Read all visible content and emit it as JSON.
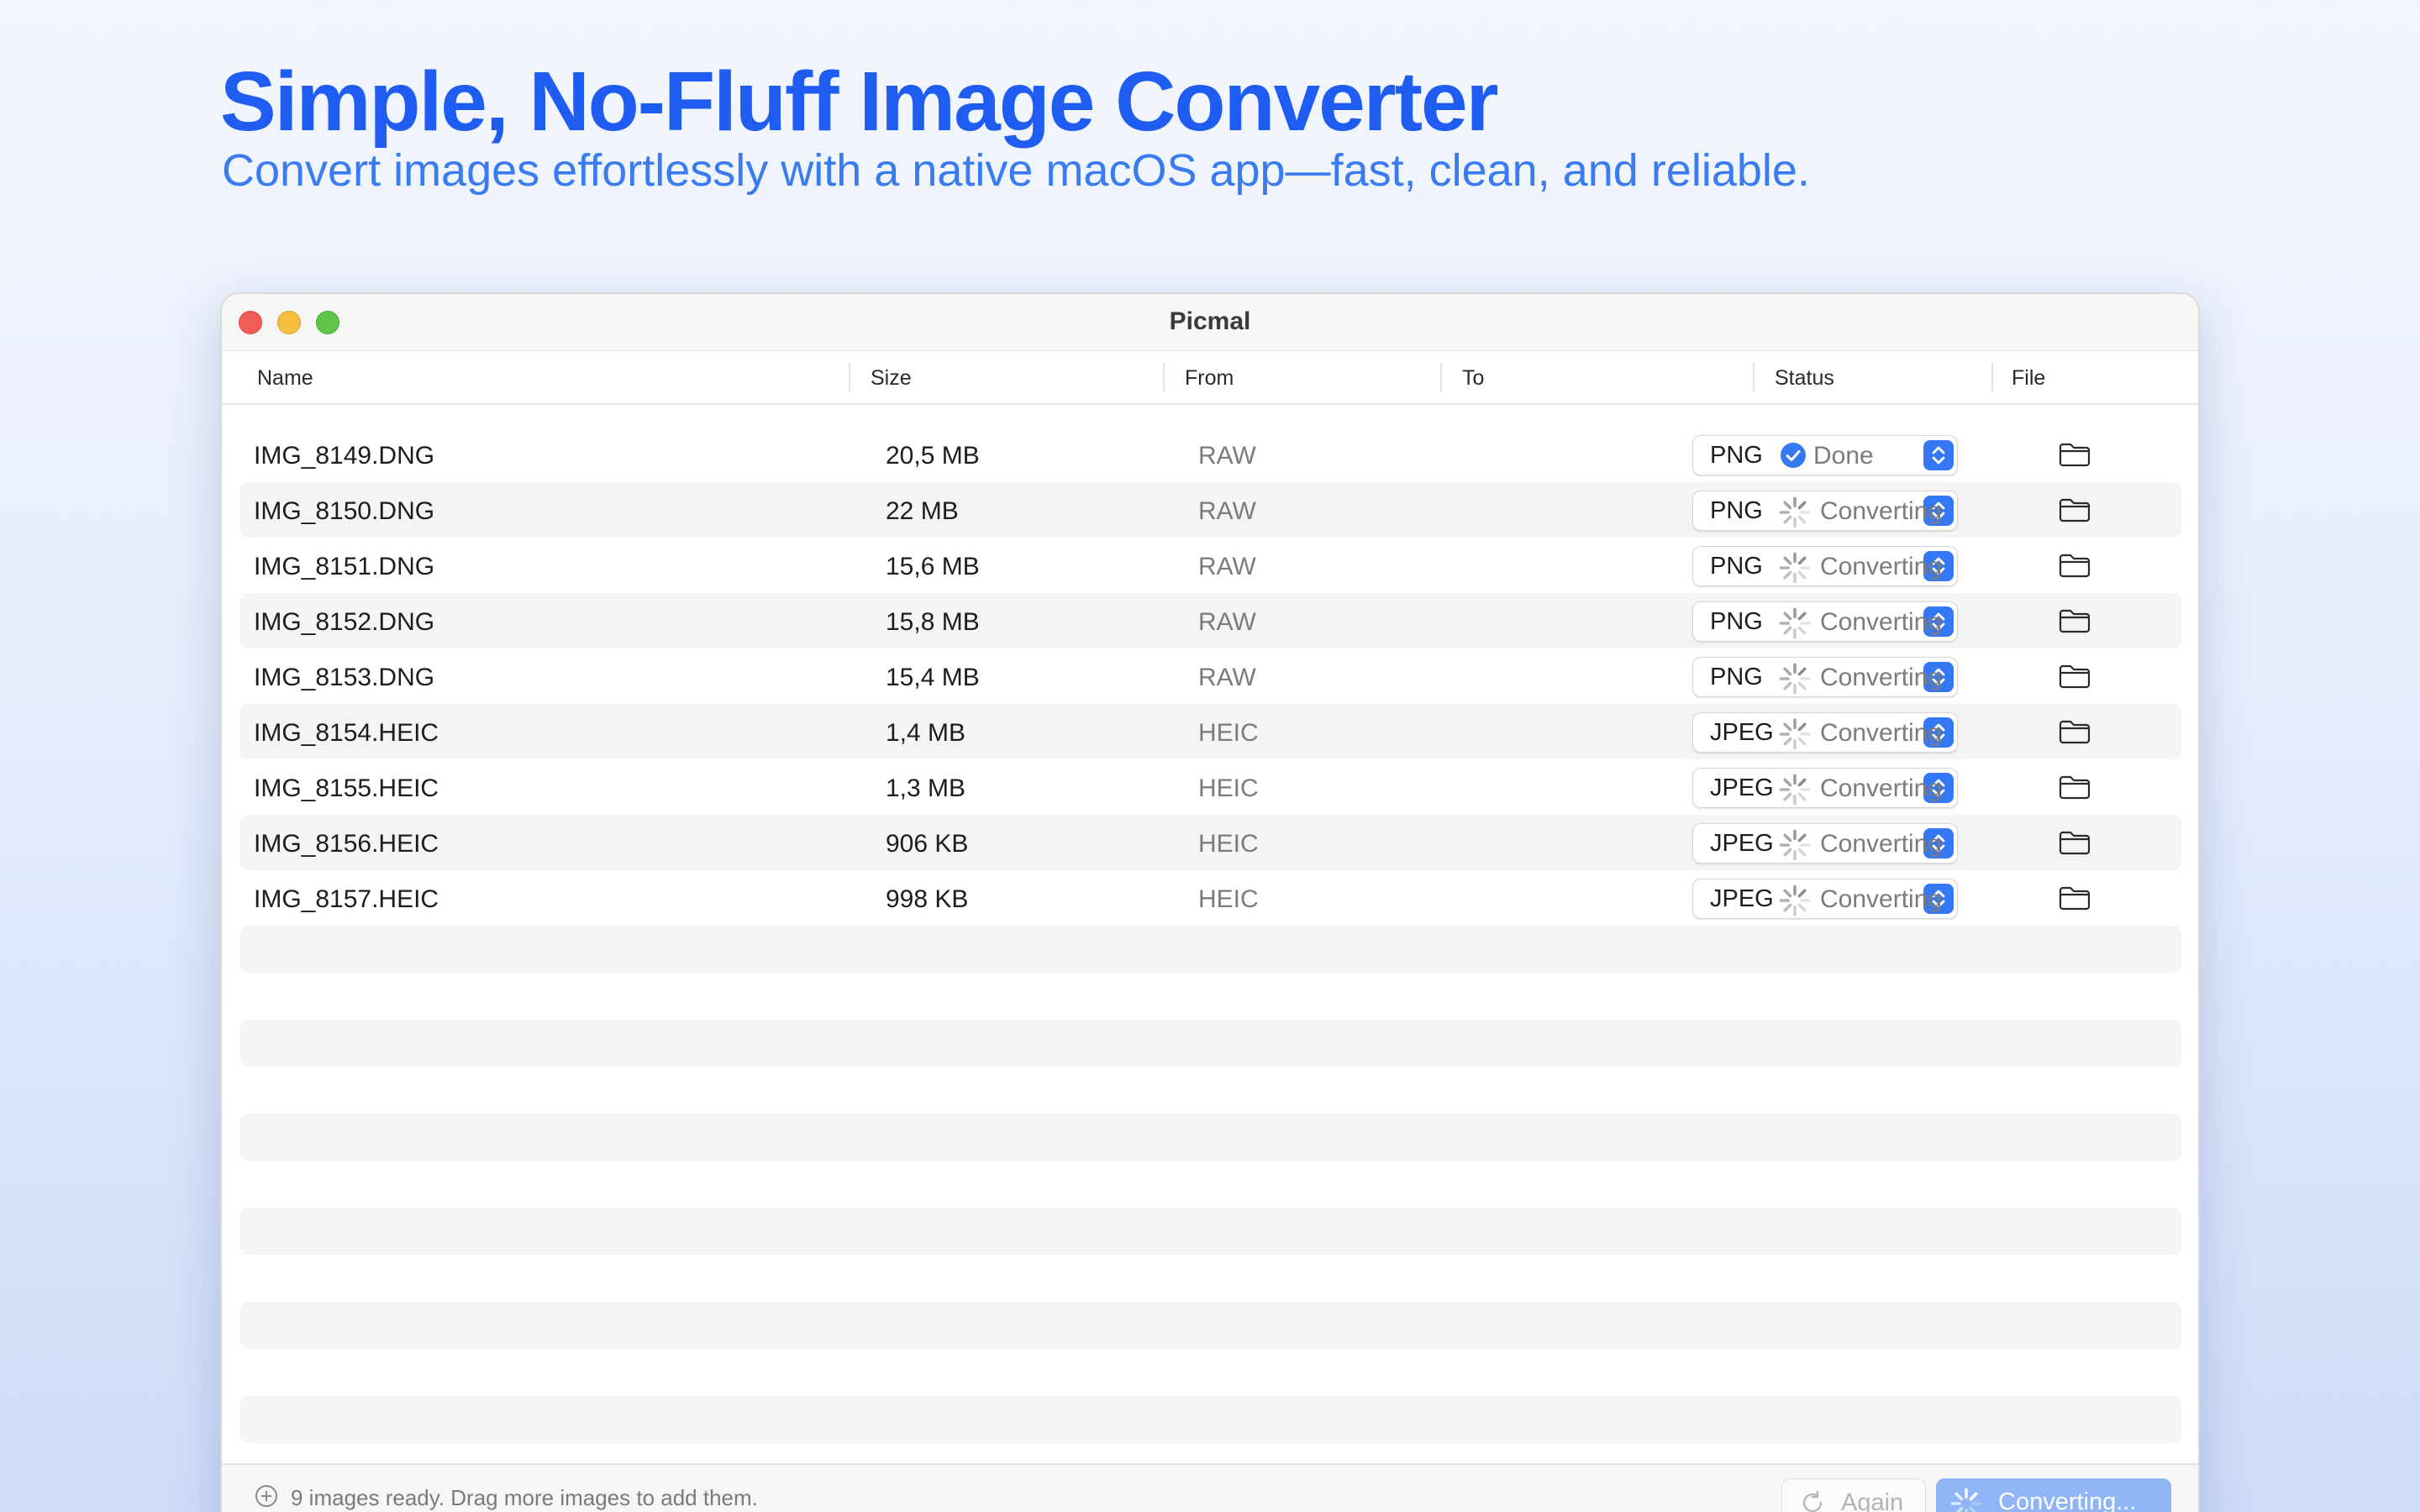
{
  "hero": {
    "title": "Simple, No-Fluff Image Converter",
    "subtitle": "Convert images effortlessly with a native macOS app—fast, clean, and reliable."
  },
  "window": {
    "title": "Picmal"
  },
  "columns": {
    "name": "Name",
    "size": "Size",
    "from": "From",
    "to": "To",
    "status": "Status",
    "file": "File"
  },
  "rows": [
    {
      "name": "IMG_8149.DNG",
      "size": "20,5 MB",
      "from": "RAW",
      "to": "PNG",
      "status": "Done",
      "status_icon": "check-circle-icon"
    },
    {
      "name": "IMG_8150.DNG",
      "size": "22 MB",
      "from": "RAW",
      "to": "PNG",
      "status": "Converting",
      "status_icon": "spinner-icon"
    },
    {
      "name": "IMG_8151.DNG",
      "size": "15,6 MB",
      "from": "RAW",
      "to": "PNG",
      "status": "Converting",
      "status_icon": "spinner-icon"
    },
    {
      "name": "IMG_8152.DNG",
      "size": "15,8 MB",
      "from": "RAW",
      "to": "PNG",
      "status": "Converting",
      "status_icon": "spinner-icon"
    },
    {
      "name": "IMG_8153.DNG",
      "size": "15,4 MB",
      "from": "RAW",
      "to": "PNG",
      "status": "Converting",
      "status_icon": "spinner-icon"
    },
    {
      "name": "IMG_8154.HEIC",
      "size": "1,4 MB",
      "from": "HEIC",
      "to": "JPEG",
      "status": "Converting",
      "status_icon": "spinner-icon"
    },
    {
      "name": "IMG_8155.HEIC",
      "size": "1,3 MB",
      "from": "HEIC",
      "to": "JPEG",
      "status": "Converting",
      "status_icon": "spinner-icon"
    },
    {
      "name": "IMG_8156.HEIC",
      "size": "906 KB",
      "from": "HEIC",
      "to": "JPEG",
      "status": "Converting",
      "status_icon": "spinner-icon"
    },
    {
      "name": "IMG_8157.HEIC",
      "size": "998 KB",
      "from": "HEIC",
      "to": "JPEG",
      "status": "Converting",
      "status_icon": "spinner-icon"
    }
  ],
  "bottom": {
    "info": "9 images ready. Drag more images to add them.",
    "again_label": "Again",
    "convert_label": "Converting..."
  },
  "colors": {
    "accent": "#3478f6",
    "headline": "#1f5cf1",
    "subhead": "#3a7cf0",
    "button_disabled": "#8fb5f7"
  }
}
